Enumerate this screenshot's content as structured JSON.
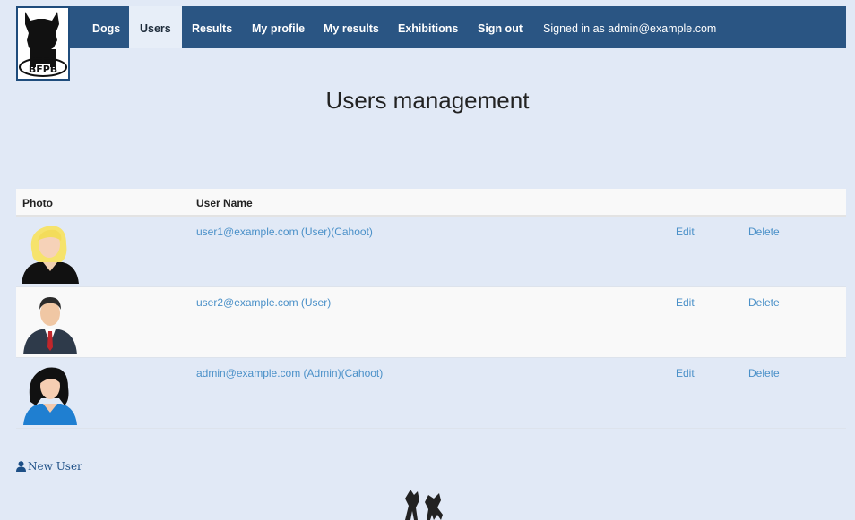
{
  "nav": {
    "items": [
      {
        "label": "Dogs",
        "active": false
      },
      {
        "label": "Users",
        "active": true
      },
      {
        "label": "Results",
        "active": false
      },
      {
        "label": "My profile",
        "active": false
      },
      {
        "label": "My results",
        "active": false
      },
      {
        "label": "Exhibitions",
        "active": false
      },
      {
        "label": "Sign out",
        "active": false
      }
    ],
    "signed_in": "Signed in as admin@example.com"
  },
  "page": {
    "title": "Users management"
  },
  "table": {
    "headers": {
      "photo": "Photo",
      "user_name": "User Name"
    },
    "rows": [
      {
        "user": "user1@example.com (User)(Cahoot)",
        "edit": "Edit",
        "delete": "Delete",
        "avatar": "blonde-woman-avatar-icon"
      },
      {
        "user": "user2@example.com (User)",
        "edit": "Edit",
        "delete": "Delete",
        "avatar": "businessman-avatar-icon"
      },
      {
        "user": "admin@example.com (Admin)(Cahoot)",
        "edit": "Edit",
        "delete": "Delete",
        "avatar": "dark-haired-woman-avatar-icon"
      }
    ]
  },
  "actions": {
    "new_user": "New User"
  },
  "colors": {
    "nav_bg": "#2a5583",
    "page_bg": "#e1e9f6",
    "link": "#4a90c8"
  }
}
